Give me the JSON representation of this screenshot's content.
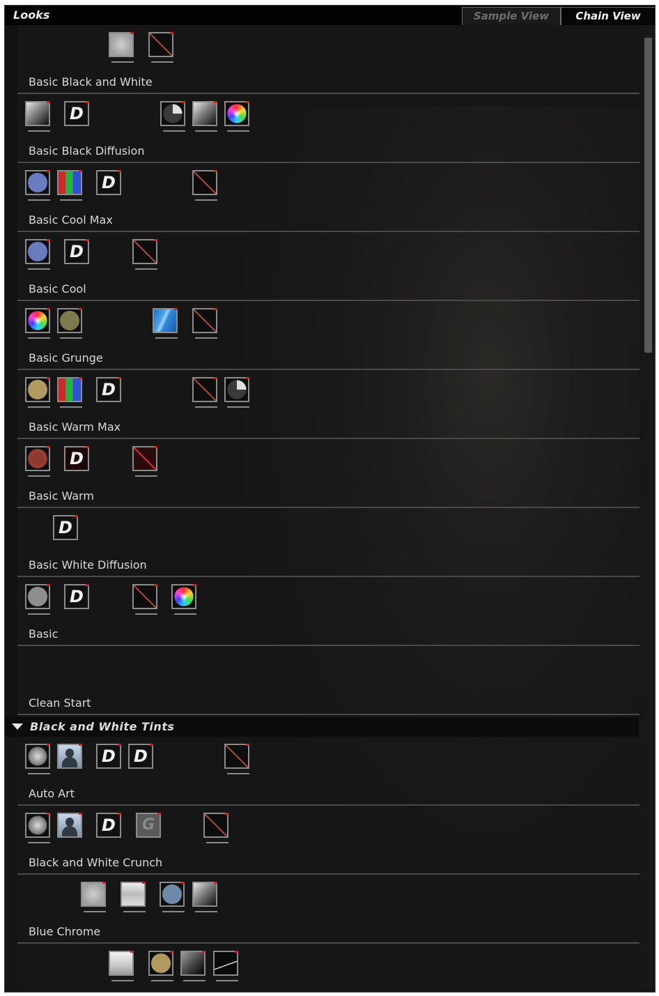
{
  "panel": {
    "title": "Looks",
    "tabs": [
      {
        "label": "Sample View",
        "active": false
      },
      {
        "label": "Chain View",
        "active": true
      }
    ]
  },
  "rows": [
    {
      "label": "Basic Black and White"
    },
    {
      "label": "Basic Black Diffusion"
    },
    {
      "label": "Basic Cool Max"
    },
    {
      "label": "Basic Cool"
    },
    {
      "label": "Basic Grunge"
    },
    {
      "label": "Basic Warm Max"
    },
    {
      "label": "Basic Warm"
    },
    {
      "label": "Basic White Diffusion"
    },
    {
      "label": "Basic"
    },
    {
      "label": "Clean Start"
    }
  ],
  "section": {
    "title": "Black and White Tints",
    "expanded": true
  },
  "section_rows": [
    {
      "label": "Auto Art"
    },
    {
      "label": "Black and White Crunch"
    },
    {
      "label": "Blue Chrome"
    },
    {
      "label": ""
    }
  ],
  "icons": {
    "diffusion_glyph": "D",
    "grain_glyph": "G"
  },
  "colors": {
    "panel_bg": "#151515",
    "titlebar_bg": "#030303",
    "divider": "#4a4a4a",
    "accent_red": "#cc2222",
    "text": "#dadada"
  }
}
